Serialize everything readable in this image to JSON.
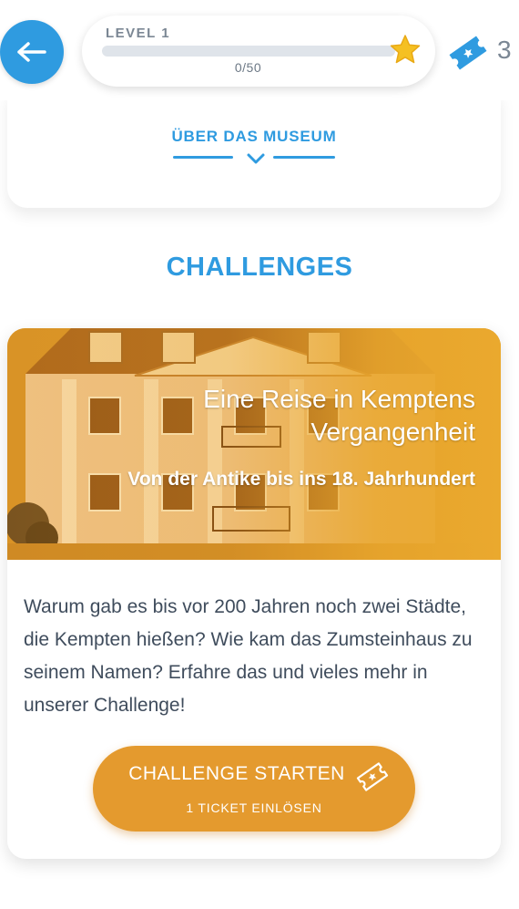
{
  "header": {
    "level_label": "LEVEL 1",
    "level_progress_text": "0/50",
    "level_progress_fraction": 0,
    "ticket_count": "3",
    "back_icon": "arrow-left-icon",
    "star_icon": "star-icon",
    "ticket_icon": "ticket-icon"
  },
  "museum": {
    "about_link_label": "ÜBER DAS MUSEUM",
    "chevron_icon": "chevron-down-icon"
  },
  "challenges": {
    "section_title": "CHALLENGES",
    "card": {
      "title": "Eine Reise in Kemptens Vergangenheit",
      "subtitle": "Von der Antike bis ins 18. Jahrhundert",
      "description": "Warum gab es bis vor 200 Jahren noch zwei Städte, die Kempten hießen? Wie kam das Zumsteinhaus zu seinem Namen? Erfahre das und vieles mehr in unserer Challenge!",
      "start_button_label": "CHALLENGE STARTEN",
      "start_button_sublabel": "1 TICKET EINLÖSEN"
    }
  },
  "colors": {
    "primary_blue": "#2f9be0",
    "accent_orange": "#e49a2e",
    "star_yellow": "#f2b21b"
  }
}
